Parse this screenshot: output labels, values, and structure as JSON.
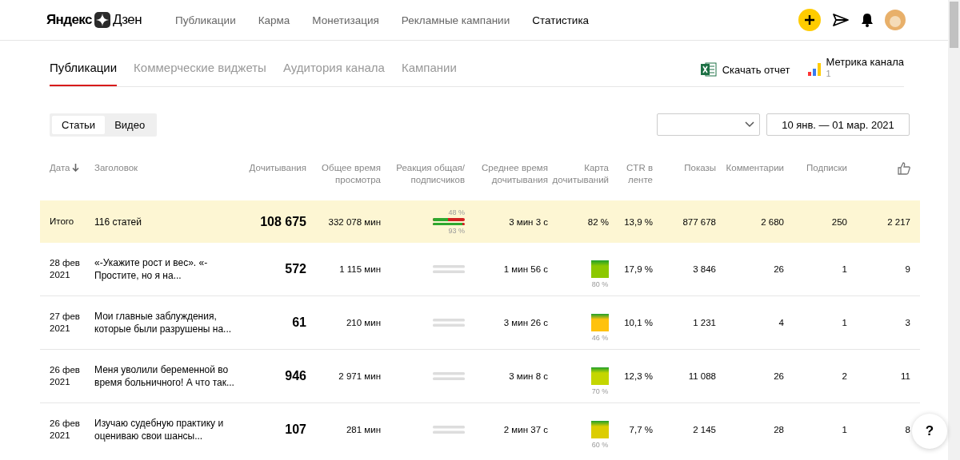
{
  "header": {
    "logo_left": "Яндекс",
    "logo_right": "Дзен",
    "nav": [
      {
        "label": "Публикации",
        "selected": false
      },
      {
        "label": "Карма",
        "selected": false
      },
      {
        "label": "Монетизация",
        "selected": false
      },
      {
        "label": "Рекламные кампании",
        "selected": false
      },
      {
        "label": "Статистика",
        "selected": true
      }
    ]
  },
  "tabs": [
    {
      "label": "Публикации",
      "selected": true
    },
    {
      "label": "Коммерческие виджеты",
      "selected": false
    },
    {
      "label": "Аудитория канала",
      "selected": false
    },
    {
      "label": "Кампании",
      "selected": false
    }
  ],
  "actions": [
    {
      "kind": "excel",
      "label": "Скачать отчет"
    },
    {
      "kind": "metrica",
      "label": "Метрика канала",
      "count": "1"
    }
  ],
  "segments": [
    {
      "label": "Статьи",
      "selected": true
    },
    {
      "label": "Видео",
      "selected": false
    }
  ],
  "date_range": "10 янв. — 01 мар. 2021",
  "table": {
    "columns": [
      {
        "label": "Дата",
        "sorted": true
      },
      {
        "label": "Заголовок",
        "sorted": false
      },
      {
        "label": "Дочитывания",
        "sorted": false
      },
      {
        "label": "Общее время просмотра",
        "sorted": false
      },
      {
        "label": "Реакция общая/ подписчиков",
        "sorted": false
      },
      {
        "label": "Среднее время дочитывания",
        "sorted": false
      },
      {
        "label": "Карта дочитываний",
        "sorted": false
      },
      {
        "label": "CTR в ленте",
        "sorted": false
      },
      {
        "label": "Показы",
        "sorted": false
      },
      {
        "label": "Комментарии",
        "sorted": false
      },
      {
        "label": "Подписки",
        "sorted": false
      },
      {
        "kind": "likes",
        "sorted": false
      }
    ],
    "total": {
      "date": "Итого",
      "title": "116 статей",
      "reads": "108 675",
      "time": "332 078 мин",
      "reaction": {
        "general": {
          "level": 0.48,
          "label": "48 %"
        },
        "subscribers": {
          "level": 0.93,
          "label": "93 %"
        }
      },
      "avg_time": "3 мин 3 с",
      "read_map": {
        "kind": "text",
        "label": "82 %"
      },
      "ctr": "13,9 %",
      "views": "877 678",
      "comments": "2 680",
      "subscriptions": "250",
      "likes": "2 217"
    },
    "rows": [
      {
        "date": "28 фев 2021",
        "title": "«-Укажите рост и вес». «-Простите, но я на...",
        "reads": "572",
        "time": "1 115 мин",
        "avg_time": "1 мин 56 с",
        "read_map": {
          "kind": "square",
          "color": "#8cc800",
          "label": "80 %"
        },
        "ctr": "17,9 %",
        "views": "3 846",
        "comments": "26",
        "subscriptions": "1",
        "likes": "9"
      },
      {
        "date": "27 фев 2021",
        "title": "Мои главные заблуждения, которые были разрушены на...",
        "reads": "61",
        "time": "210 мин",
        "avg_time": "3 мин 26 с",
        "read_map": {
          "kind": "square",
          "color": "#ffc20e",
          "label": "46 %"
        },
        "ctr": "10,1 %",
        "views": "1 231",
        "comments": "4",
        "subscriptions": "1",
        "likes": "3"
      },
      {
        "date": "26 фев 2021",
        "title": "Меня уволили беременной во время больничного! А что так...",
        "reads": "946",
        "time": "2 971 мин",
        "avg_time": "3 мин 8 с",
        "read_map": {
          "kind": "square",
          "color": "#c4d600",
          "label": "70 %"
        },
        "ctr": "12,3 %",
        "views": "11 088",
        "comments": "26",
        "subscriptions": "2",
        "likes": "11"
      },
      {
        "date": "26 фев 2021",
        "title": "Изучаю судебную практику и оцениваю свои шансы...",
        "reads": "107",
        "time": "281 мин",
        "avg_time": "2 мин 37 с",
        "read_map": {
          "kind": "square",
          "color": "#dccd00",
          "label": "60 %"
        },
        "ctr": "7,7 %",
        "views": "2 145",
        "comments": "28",
        "subscriptions": "1",
        "likes": "8"
      }
    ]
  },
  "help": "?"
}
